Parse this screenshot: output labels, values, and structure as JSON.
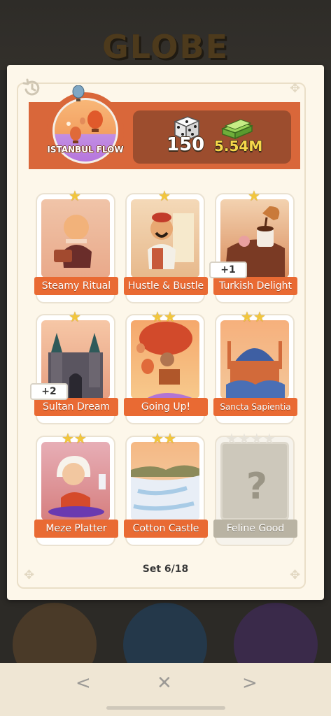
{
  "background": {
    "title": "GLOBE"
  },
  "set": {
    "name": "ISTANBUL FLOW",
    "reward_dice": "150",
    "reward_cash": "5.54M",
    "progress": "Set 6/18"
  },
  "cards": [
    {
      "label": "Steamy Ritual",
      "stars": 1,
      "duplicates": null,
      "locked": false
    },
    {
      "label": "Hustle & Bustle",
      "stars": 1,
      "duplicates": null,
      "locked": false
    },
    {
      "label": "Turkish Delight",
      "stars": 1,
      "duplicates": "+1",
      "locked": false
    },
    {
      "label": "Sultan Dream",
      "stars": 1,
      "duplicates": "+2",
      "locked": false
    },
    {
      "label": "Going Up!",
      "stars": 2,
      "duplicates": null,
      "locked": false
    },
    {
      "label": "Sancta Sapientia",
      "stars": 2,
      "duplicates": null,
      "locked": false
    },
    {
      "label": "Meze Platter",
      "stars": 2,
      "duplicates": null,
      "locked": false
    },
    {
      "label": "Cotton Castle",
      "stars": 2,
      "duplicates": null,
      "locked": false
    },
    {
      "label": "Feline Good",
      "stars": 4,
      "duplicates": null,
      "locked": true
    }
  ],
  "nav": {
    "prev": "<",
    "close": "✕",
    "next": ">"
  },
  "colors": {
    "header": "#d9673a",
    "label": "#e96a33",
    "star": "#f2c63c"
  }
}
